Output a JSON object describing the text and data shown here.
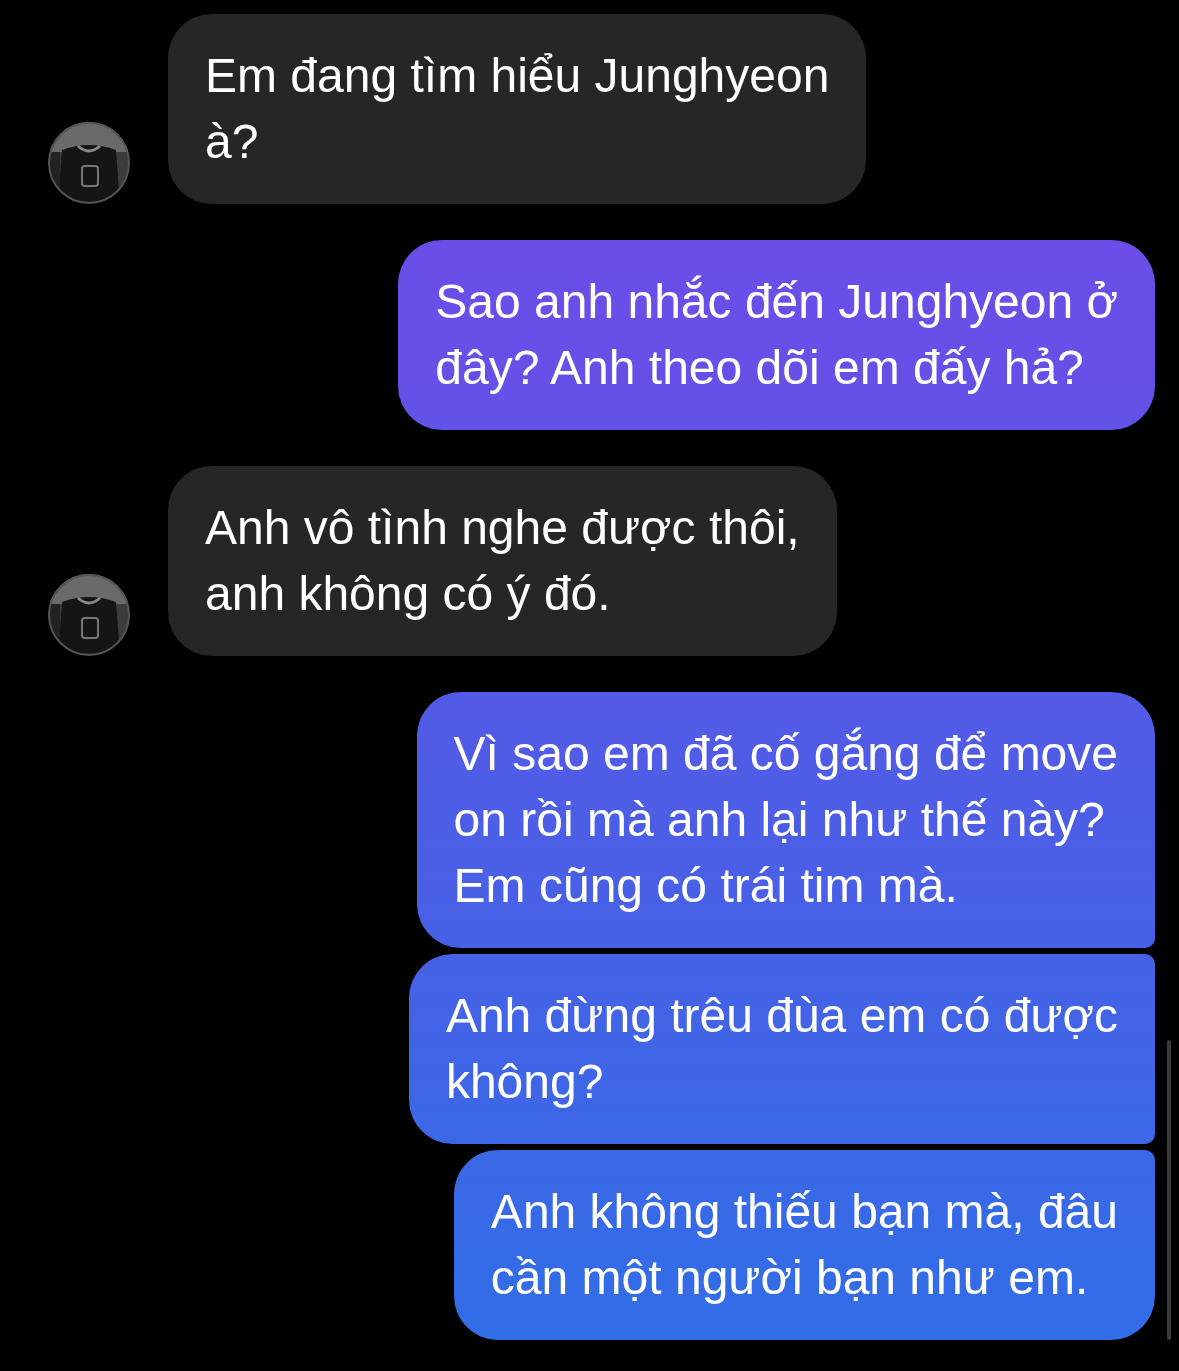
{
  "messages": [
    {
      "kind": "received",
      "text": "Em đang tìm hiểu Junghyeon\nà?"
    },
    {
      "kind": "sent",
      "text": "Sao anh nhắc đến Junghyeon ở\nđây? Anh theo dõi em đấy hả?"
    },
    {
      "kind": "received",
      "text": "Anh vô tình nghe được thôi,\nanh không có ý đó."
    },
    {
      "kind": "sent",
      "text": "Vì sao em đã cố gắng để move\non rồi mà anh lại như thế này?\nEm cũng có trái tim mà."
    },
    {
      "kind": "sent",
      "text": "Anh đừng trêu đùa em có được\nkhông?"
    },
    {
      "kind": "sent",
      "text": "Anh không thiếu bạn mà, đâu\ncần một người bạn như em."
    }
  ]
}
